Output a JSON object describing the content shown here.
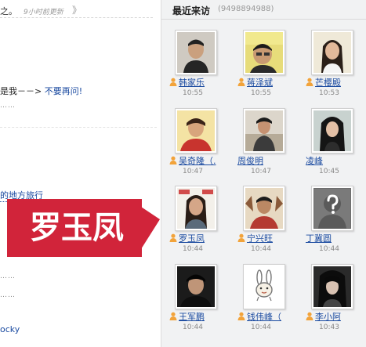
{
  "feed": {
    "title_fragment": "之。",
    "updated": "9小时前更新",
    "chevron": "》",
    "status_prefix": "是我－－>",
    "status_link": "不要再问!",
    "dots": "……",
    "trip_fragment": "的地方旅行",
    "rocky": "ocky"
  },
  "banner": {
    "text": "罗玉凤",
    "color": "#d1243a"
  },
  "recent": {
    "title": "最近来访",
    "count": "(9498894988)",
    "visitors": [
      {
        "name": "韩家乐",
        "time": "10:55",
        "icon": "user-icon"
      },
      {
        "name": "蒋泽斌",
        "time": "10:55",
        "icon": "user-icon"
      },
      {
        "name": "芒樱殿",
        "time": "10:53",
        "icon": "user-icon"
      },
      {
        "name": "吴奇隆（.",
        "time": "10:47",
        "icon": "user-icon"
      },
      {
        "name": "周俊明",
        "time": "10:47",
        "icon": ""
      },
      {
        "name": "凌峰",
        "time": "10:45",
        "icon": ""
      },
      {
        "name": "罗玉凤",
        "time": "10:44",
        "icon": "user-icon"
      },
      {
        "name": "宁兴旺",
        "time": "10:44",
        "icon": "user-icon"
      },
      {
        "name": "丁冀圆",
        "time": "10:44",
        "icon": ""
      },
      {
        "name": "王军鹏",
        "time": "10:44",
        "icon": "user-icon"
      },
      {
        "name": "钱伟峰（",
        "time": "10:44",
        "icon": "user-icon"
      },
      {
        "name": "李小阿",
        "time": "10:43",
        "icon": "user-icon"
      }
    ]
  }
}
